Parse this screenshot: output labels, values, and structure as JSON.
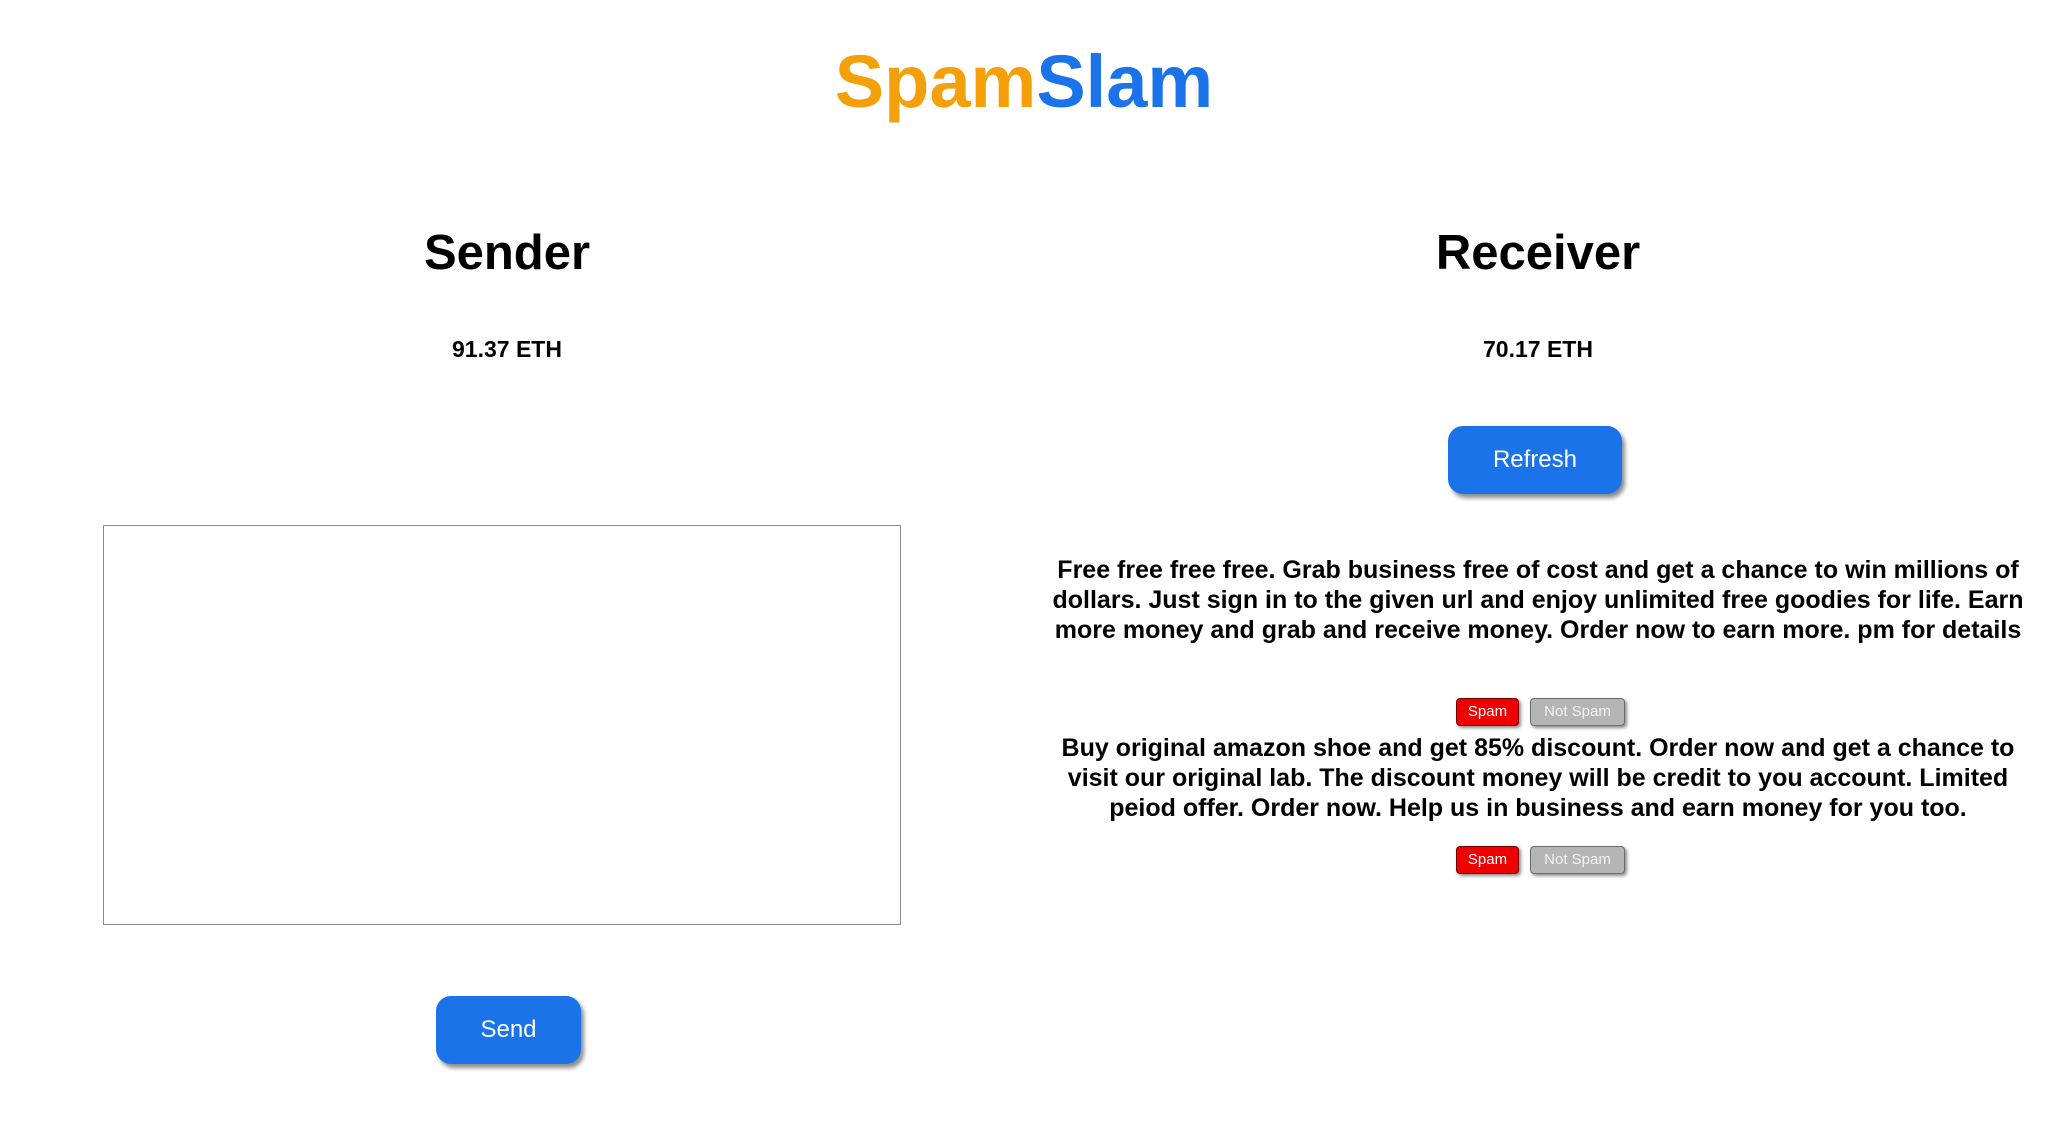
{
  "app": {
    "title_part1": "Spam",
    "title_part2": "Slam",
    "title_colors": {
      "spam": "#f5a00a",
      "slam": "#1a73e8"
    }
  },
  "sender": {
    "heading": "Sender",
    "balance": "91.37 ETH",
    "message_input": {
      "value": "",
      "placeholder": ""
    },
    "send_label": "Send"
  },
  "receiver": {
    "heading": "Receiver",
    "balance": "70.17 ETH",
    "refresh_label": "Refresh",
    "messages": [
      {
        "text": "Free free free free. Grab business free of cost and get a chance to win millions of dollars. Just sign in to the given url and enjoy unlimited free goodies for life. Earn more money and grab and receive money. Order now to earn more. pm for details",
        "spam_label": "Spam",
        "not_spam_label": "Not Spam"
      },
      {
        "text": "Buy original amazon shoe and get 85% discount. Order now and get a chance to visit our original lab. The discount money will be credit to you account. Limited peiod offer. Order now. Help us in business and earn money for you too.",
        "spam_label": "Spam",
        "not_spam_label": "Not Spam"
      }
    ]
  },
  "colors": {
    "primary_button": "#1a73e8",
    "spam_button": "#ee0000",
    "not_spam_button": "#b5b5b5"
  }
}
